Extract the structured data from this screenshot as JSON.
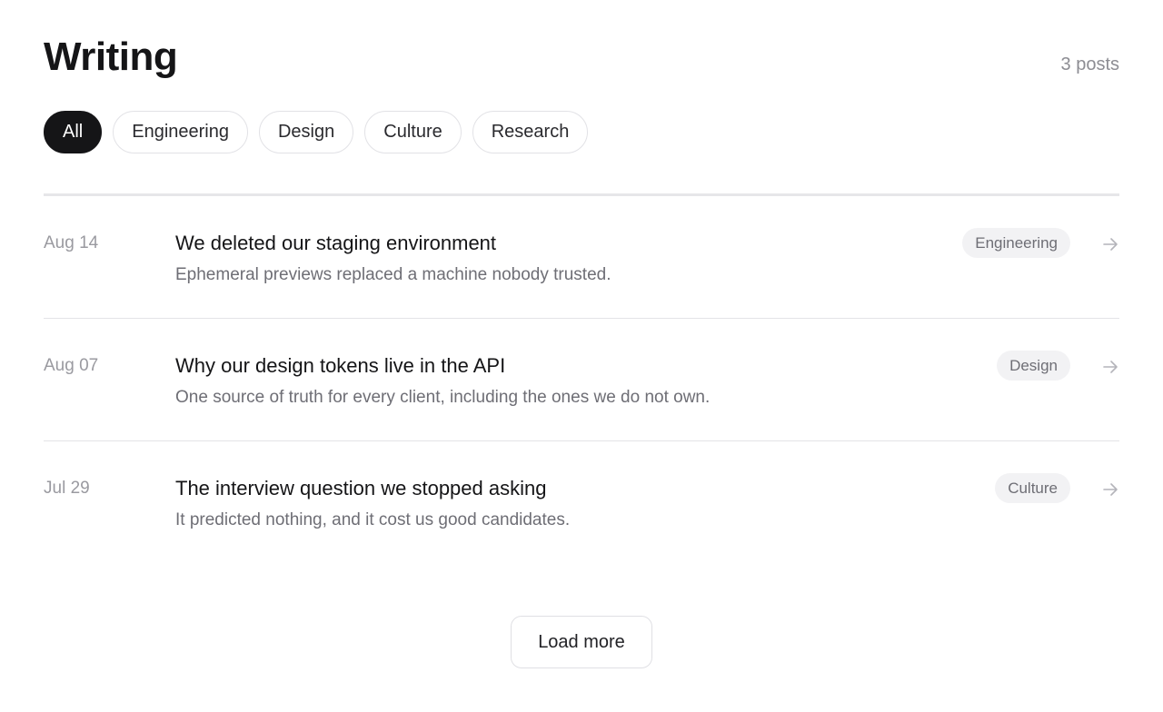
{
  "header": {
    "title": "Writing",
    "post_count": "3 posts"
  },
  "filters": [
    {
      "label": "All",
      "active": true
    },
    {
      "label": "Engineering",
      "active": false
    },
    {
      "label": "Design",
      "active": false
    },
    {
      "label": "Culture",
      "active": false
    },
    {
      "label": "Research",
      "active": false
    }
  ],
  "posts": [
    {
      "date": "Aug 14",
      "title": "We deleted our staging environment",
      "excerpt": "Ephemeral previews replaced a machine nobody trusted.",
      "tag": "Engineering"
    },
    {
      "date": "Aug 07",
      "title": "Why our design tokens live in the API",
      "excerpt": "One source of truth for every client, including the ones we do not own.",
      "tag": "Design"
    },
    {
      "date": "Jul 29",
      "title": "The interview question we stopped asking",
      "excerpt": "It predicted nothing, and it cost us good candidates.",
      "tag": "Culture"
    }
  ],
  "load_more_label": "Load more",
  "icons": {
    "row_arrow": "arrow-right-icon"
  },
  "colors": {
    "active_chip_bg": "#151517",
    "active_chip_text": "#ffffff",
    "tag_bg": "#f2f2f4",
    "muted_text": "#9a9aa0"
  }
}
